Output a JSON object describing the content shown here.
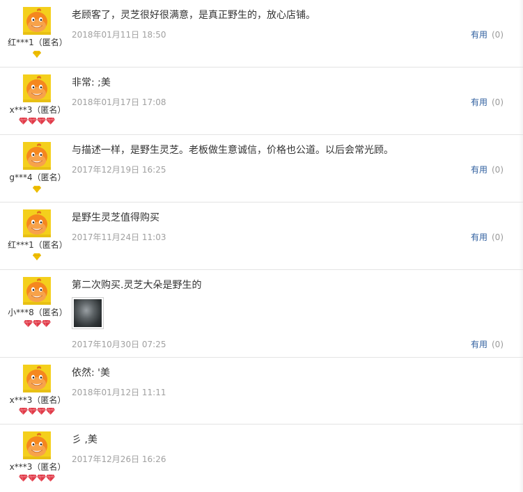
{
  "useful_label": "有用",
  "icons": {
    "avatar": "orange-mascot-avatar",
    "vip": "gold-diamond-icon",
    "level": "red-heart-icon"
  },
  "colors": {
    "avatar": "#f5871f",
    "avatar_bg": "#f4cf1c",
    "useful_link": "#2f5f9f",
    "date": "#a0a0a0",
    "heart": "#e03a48",
    "diamond": "#f2c200"
  },
  "reviews": [
    {
      "user": "红***1（匿名）",
      "badge": "diamond",
      "badge_count": 1,
      "content": "老顾客了，灵芝很好很满意，是真正野生的，放心店铺。",
      "date": "2018年01月11日 18:50",
      "useful": "(0)",
      "has_photo": false
    },
    {
      "user": "x***3（匿名）",
      "badge": "heart",
      "badge_count": 4,
      "content": "非常: ;美",
      "date": "2018年01月17日 17:08",
      "useful": "(0)",
      "has_photo": false
    },
    {
      "user": "g***4（匿名）",
      "badge": "diamond",
      "badge_count": 1,
      "content": "与描述一样，是野生灵芝。老板做生意诚信，价格也公道。以后会常光顾。",
      "date": "2017年12月19日 16:25",
      "useful": "(0)",
      "has_photo": false
    },
    {
      "user": "红***1（匿名）",
      "badge": "diamond",
      "badge_count": 1,
      "content": "是野生灵芝值得购买",
      "date": "2017年11月24日 11:03",
      "useful": "(0)",
      "has_photo": false
    },
    {
      "user": "小***8（匿名）",
      "badge": "heart",
      "badge_count": 3,
      "content": "第二次购买.灵芝大朵是野生的",
      "date": "2017年10月30日 07:25",
      "useful": "(0)",
      "has_photo": true
    },
    {
      "user": "x***3（匿名）",
      "badge": "heart",
      "badge_count": 4,
      "content": "依然: '美",
      "date": "2018年01月12日 11:11",
      "useful": "",
      "has_photo": false
    },
    {
      "user": "x***3（匿名）",
      "badge": "heart",
      "badge_count": 4,
      "content": "彡 ,美",
      "date": "2017年12月26日 16:26",
      "useful": "",
      "has_photo": false
    }
  ]
}
